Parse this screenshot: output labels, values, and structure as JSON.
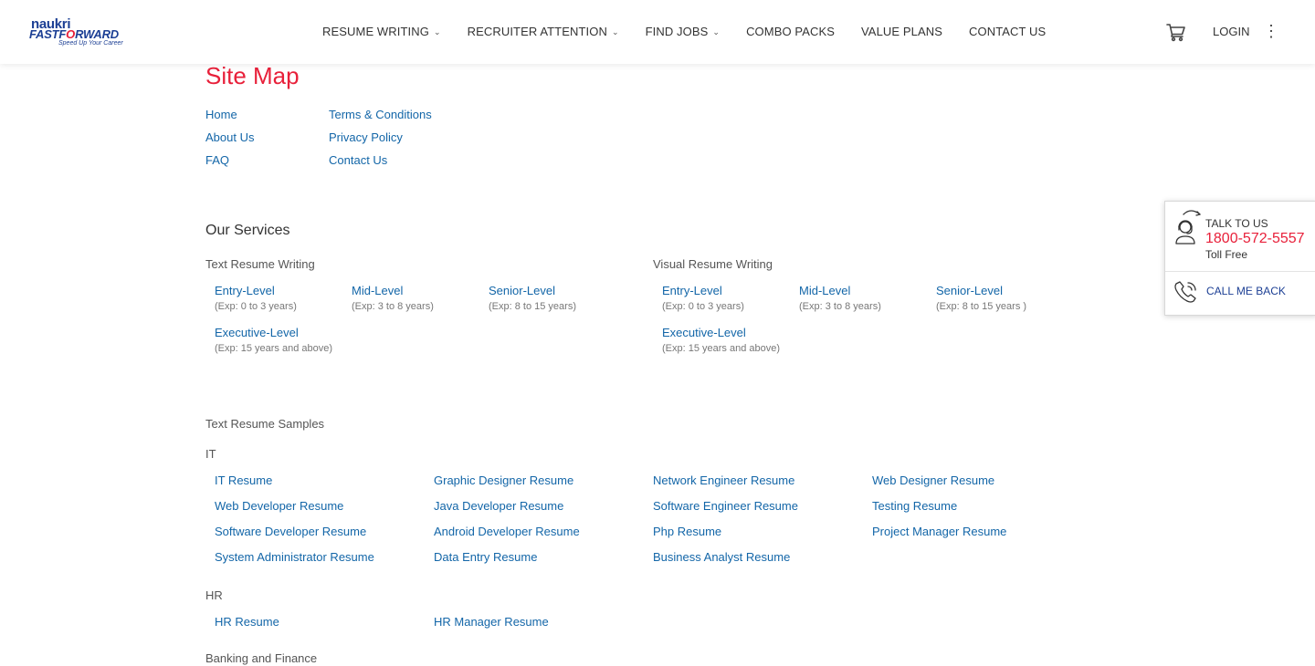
{
  "header": {
    "logo": {
      "line1": "naukri",
      "line2a": "FASTF",
      "line2b": "O",
      "line2c": "RWARD",
      "tagline": "Speed Up Your Career"
    },
    "nav": [
      {
        "label": "RESUME WRITING",
        "dropdown": true
      },
      {
        "label": "RECRUITER ATTENTION",
        "dropdown": true
      },
      {
        "label": "FIND JOBS",
        "dropdown": true
      },
      {
        "label": "COMBO PACKS",
        "dropdown": false
      },
      {
        "label": "VALUE PLANS",
        "dropdown": false
      },
      {
        "label": "CONTACT US",
        "dropdown": false
      }
    ],
    "login": "LOGIN",
    "icons": {
      "cart": "cart-icon",
      "more": "kebab-menu-icon",
      "chevron": "chevron-down-icon"
    }
  },
  "page": {
    "title": "Site Map",
    "links_col1": [
      "Home",
      "About Us",
      "FAQ"
    ],
    "links_col2": [
      "Terms & Conditions",
      "Privacy Policy",
      "Contact Us"
    ]
  },
  "services": {
    "heading": "Our Services",
    "text_resume": {
      "label": "Text Resume Writing",
      "items": [
        {
          "name": "Entry-Level",
          "exp": "(Exp: 0 to 3 years)"
        },
        {
          "name": "Mid-Level",
          "exp": "(Exp: 3 to 8 years)"
        },
        {
          "name": "Senior-Level",
          "exp": "(Exp: 8 to 15 years)"
        },
        {
          "name": "Executive-Level",
          "exp": "(Exp: 15 years and above)"
        }
      ]
    },
    "visual_resume": {
      "label": "Visual Resume Writing",
      "items": [
        {
          "name": "Entry-Level",
          "exp": "(Exp: 0 to 3 years)"
        },
        {
          "name": "Mid-Level",
          "exp": "(Exp: 3 to 8 years)"
        },
        {
          "name": "Senior-Level",
          "exp": "(Exp: 8 to 15 years )"
        },
        {
          "name": "Executive-Level",
          "exp": "(Exp: 15 years and above)"
        }
      ]
    }
  },
  "samples": {
    "label": "Text Resume Samples",
    "it": {
      "label": "IT",
      "rows": [
        [
          "IT Resume",
          "Graphic Designer Resume",
          "Network Engineer Resume",
          "Web Designer Resume"
        ],
        [
          "Web Developer Resume",
          "Java Developer Resume",
          "Software Engineer Resume",
          "Testing Resume"
        ],
        [
          "Software Developer Resume",
          "Android Developer Resume",
          "Php Resume",
          "Project Manager Resume"
        ],
        [
          "System Administrator Resume",
          "Data Entry Resume",
          "Business Analyst Resume"
        ]
      ]
    },
    "hr": {
      "label": "HR",
      "rows": [
        [
          "HR Resume",
          "HR Manager Resume"
        ]
      ]
    },
    "banking_label": "Banking and Finance"
  },
  "contact_widget": {
    "talk_label": "TALK TO US",
    "phone": "1800-572-5557",
    "toll_free": "Toll Free",
    "call_back": "CALL ME BACK"
  }
}
